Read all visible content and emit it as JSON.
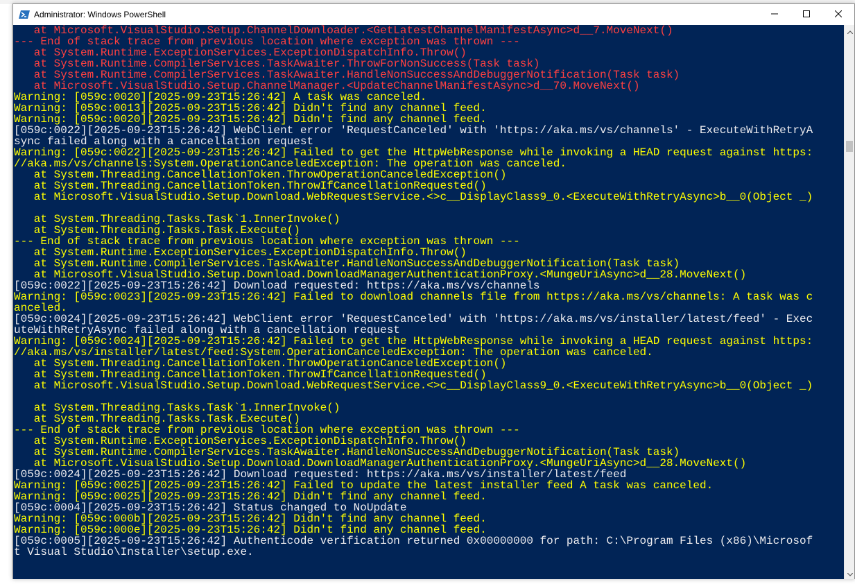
{
  "window": {
    "title": "Administrator: Windows PowerShell",
    "icon": "powershell-icon",
    "controls": [
      "minimize-icon",
      "maximize-icon",
      "close-icon"
    ]
  },
  "colors": {
    "console_bg": "#012456",
    "text_normal": "#eeedf0",
    "text_warning": "#ffff00",
    "text_error": "#ff4040"
  },
  "scrollbar": {
    "position_fraction": 0.2
  },
  "console": {
    "lines": [
      {
        "type": "err",
        "text": "   at Microsoft.VisualStudio.Setup.ChannelDownloader.<GetLatestChannelManifestAsync>d__7.MoveNext()"
      },
      {
        "type": "err",
        "text": "--- End of stack trace from previous location where exception was thrown ---"
      },
      {
        "type": "err",
        "text": "   at System.Runtime.ExceptionServices.ExceptionDispatchInfo.Throw()"
      },
      {
        "type": "err",
        "text": "   at System.Runtime.CompilerServices.TaskAwaiter.ThrowForNonSuccess(Task task)"
      },
      {
        "type": "err",
        "text": "   at System.Runtime.CompilerServices.TaskAwaiter.HandleNonSuccessAndDebuggerNotification(Task task)"
      },
      {
        "type": "err",
        "text": "   at Microsoft.VisualStudio.Setup.ChannelManager.<UpdateChannelManifestAsync>d__70.MoveNext()"
      },
      {
        "type": "warn",
        "text": "Warning: [059c:0020][2025-09-23T15:26:42] A task was canceled."
      },
      {
        "type": "warn",
        "text": "Warning: [059c:0013][2025-09-23T15:26:42] Didn't find any channel feed."
      },
      {
        "type": "warn",
        "text": "Warning: [059c:0020][2025-09-23T15:26:42] Didn't find any channel feed."
      },
      {
        "type": "normal",
        "text": "[059c:0022][2025-09-23T15:26:42] WebClient error 'RequestCanceled' with 'https://aka.ms/vs/channels' - ExecuteWithRetryA"
      },
      {
        "type": "normal",
        "text": "sync failed along with a cancellation request"
      },
      {
        "type": "warn",
        "text": "Warning: [059c:0022][2025-09-23T15:26:42] Failed to get the HttpWebResponse while invoking a HEAD request against https:"
      },
      {
        "type": "warn",
        "text": "//aka.ms/vs/channels:System.OperationCanceledException: The operation was canceled."
      },
      {
        "type": "warn",
        "text": "   at System.Threading.CancellationToken.ThrowOperationCanceledException()"
      },
      {
        "type": "warn",
        "text": "   at System.Threading.CancellationToken.ThrowIfCancellationRequested()"
      },
      {
        "type": "warn",
        "text": "   at Microsoft.VisualStudio.Setup.Download.WebRequestService.<>c__DisplayClass9_0.<ExecuteWithRetryAsync>b__0(Object _)"
      },
      {
        "type": "empty",
        "text": " "
      },
      {
        "type": "warn",
        "text": "   at System.Threading.Tasks.Task`1.InnerInvoke()"
      },
      {
        "type": "warn",
        "text": "   at System.Threading.Tasks.Task.Execute()"
      },
      {
        "type": "warn",
        "text": "--- End of stack trace from previous location where exception was thrown ---"
      },
      {
        "type": "warn",
        "text": "   at System.Runtime.ExceptionServices.ExceptionDispatchInfo.Throw()"
      },
      {
        "type": "warn",
        "text": "   at System.Runtime.CompilerServices.TaskAwaiter.HandleNonSuccessAndDebuggerNotification(Task task)"
      },
      {
        "type": "warn",
        "text": "   at Microsoft.VisualStudio.Setup.Download.DownloadManagerAuthenticationProxy.<MungeUriAsync>d__28.MoveNext()"
      },
      {
        "type": "normal",
        "text": "[059c:0022][2025-09-23T15:26:42] Download requested: https://aka.ms/vs/channels"
      },
      {
        "type": "warn",
        "text": "Warning: [059c:0023][2025-09-23T15:26:42] Failed to download channels file from https://aka.ms/vs/channels: A task was c"
      },
      {
        "type": "warn",
        "text": "anceled."
      },
      {
        "type": "normal",
        "text": "[059c:0024][2025-09-23T15:26:42] WebClient error 'RequestCanceled' with 'https://aka.ms/vs/installer/latest/feed' - Exec"
      },
      {
        "type": "normal",
        "text": "uteWithRetryAsync failed along with a cancellation request"
      },
      {
        "type": "warn",
        "text": "Warning: [059c:0024][2025-09-23T15:26:42] Failed to get the HttpWebResponse while invoking a HEAD request against https:"
      },
      {
        "type": "warn",
        "text": "//aka.ms/vs/installer/latest/feed:System.OperationCanceledException: The operation was canceled."
      },
      {
        "type": "warn",
        "text": "   at System.Threading.CancellationToken.ThrowOperationCanceledException()"
      },
      {
        "type": "warn",
        "text": "   at System.Threading.CancellationToken.ThrowIfCancellationRequested()"
      },
      {
        "type": "warn",
        "text": "   at Microsoft.VisualStudio.Setup.Download.WebRequestService.<>c__DisplayClass9_0.<ExecuteWithRetryAsync>b__0(Object _)"
      },
      {
        "type": "empty",
        "text": " "
      },
      {
        "type": "warn",
        "text": "   at System.Threading.Tasks.Task`1.InnerInvoke()"
      },
      {
        "type": "warn",
        "text": "   at System.Threading.Tasks.Task.Execute()"
      },
      {
        "type": "warn",
        "text": "--- End of stack trace from previous location where exception was thrown ---"
      },
      {
        "type": "warn",
        "text": "   at System.Runtime.ExceptionServices.ExceptionDispatchInfo.Throw()"
      },
      {
        "type": "warn",
        "text": "   at System.Runtime.CompilerServices.TaskAwaiter.HandleNonSuccessAndDebuggerNotification(Task task)"
      },
      {
        "type": "warn",
        "text": "   at Microsoft.VisualStudio.Setup.Download.DownloadManagerAuthenticationProxy.<MungeUriAsync>d__28.MoveNext()"
      },
      {
        "type": "normal",
        "text": "[059c:0024][2025-09-23T15:26:42] Download requested: https://aka.ms/vs/installer/latest/feed"
      },
      {
        "type": "warn",
        "text": "Warning: [059c:0025][2025-09-23T15:26:42] Failed to update the latest installer feed A task was canceled."
      },
      {
        "type": "warn",
        "text": "Warning: [059c:0025][2025-09-23T15:26:42] Didn't find any channel feed."
      },
      {
        "type": "normal",
        "text": "[059c:0004][2025-09-23T15:26:42] Status changed to NoUpdate"
      },
      {
        "type": "warn",
        "text": "Warning: [059c:000b][2025-09-23T15:26:42] Didn't find any channel feed."
      },
      {
        "type": "warn",
        "text": "Warning: [059c:000e][2025-09-23T15:26:42] Didn't find any channel feed."
      },
      {
        "type": "normal",
        "text": "[059c:0005][2025-09-23T15:26:42] Authenticode verification returned 0x00000000 for path: C:\\Program Files (x86)\\Microsof"
      },
      {
        "type": "normal",
        "text": "t Visual Studio\\Installer\\setup.exe."
      }
    ]
  }
}
